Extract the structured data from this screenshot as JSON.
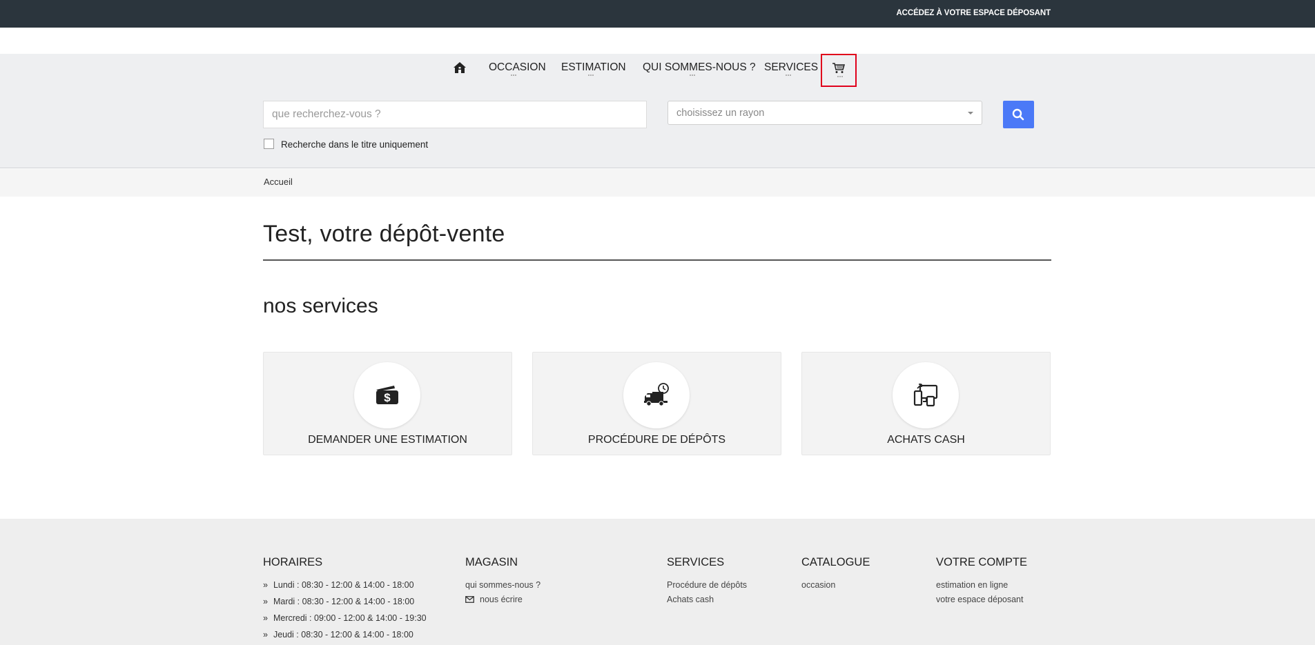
{
  "topbar": {
    "depositor_link": "ACCÉDEZ À VOTRE ESPACE DÉPOSANT"
  },
  "nav": {
    "items": [
      {
        "label": "OCCASION"
      },
      {
        "label": "ESTIMATION"
      },
      {
        "label": "QUI SOMMES-NOUS ?"
      },
      {
        "label": "SERVICES"
      }
    ],
    "icons": [
      "home-icon",
      "cart-icon"
    ]
  },
  "search": {
    "placeholder": "que recherchez-vous ?",
    "rayon_value": "choisissez un rayon",
    "title_only_label": "Recherche dans le titre uniquement"
  },
  "breadcrumb": {
    "home": "Accueil"
  },
  "main": {
    "title": "Test, votre dépôt-vente",
    "services_title": "nos services",
    "cards": [
      {
        "label": "DEMANDER UNE ESTIMATION",
        "icon": "money-icon"
      },
      {
        "label": "PROCÉDURE DE DÉPÔTS",
        "icon": "delivery-truck-icon"
      },
      {
        "label": "ACHATS CASH",
        "icon": "devices-icon"
      }
    ]
  },
  "footer": {
    "horaires": {
      "title": "HORAIRES",
      "rows": [
        "Lundi : 08:30 - 12:00 & 14:00 - 18:00",
        "Mardi : 08:30 - 12:00 & 14:00 - 18:00",
        "Mercredi : 09:00 - 12:00 & 14:00 - 19:30",
        "Jeudi : 08:30 - 12:00 & 14:00 - 18:00"
      ]
    },
    "magasin": {
      "title": "MAGASIN",
      "links": [
        "qui sommes-nous ?",
        "nous écrire"
      ]
    },
    "services": {
      "title": "SERVICES",
      "links": [
        "Procédure de dépôts",
        "Achats cash"
      ]
    },
    "catalogue": {
      "title": "CATALOGUE",
      "links": [
        "occasion"
      ]
    },
    "compte": {
      "title": "VOTRE COMPTE",
      "links": [
        "estimation en ligne",
        "votre espace déposant"
      ]
    }
  },
  "colors": {
    "topbar": "#2b353d",
    "accent": "#4b79f7",
    "highlight": "#e0001b"
  }
}
